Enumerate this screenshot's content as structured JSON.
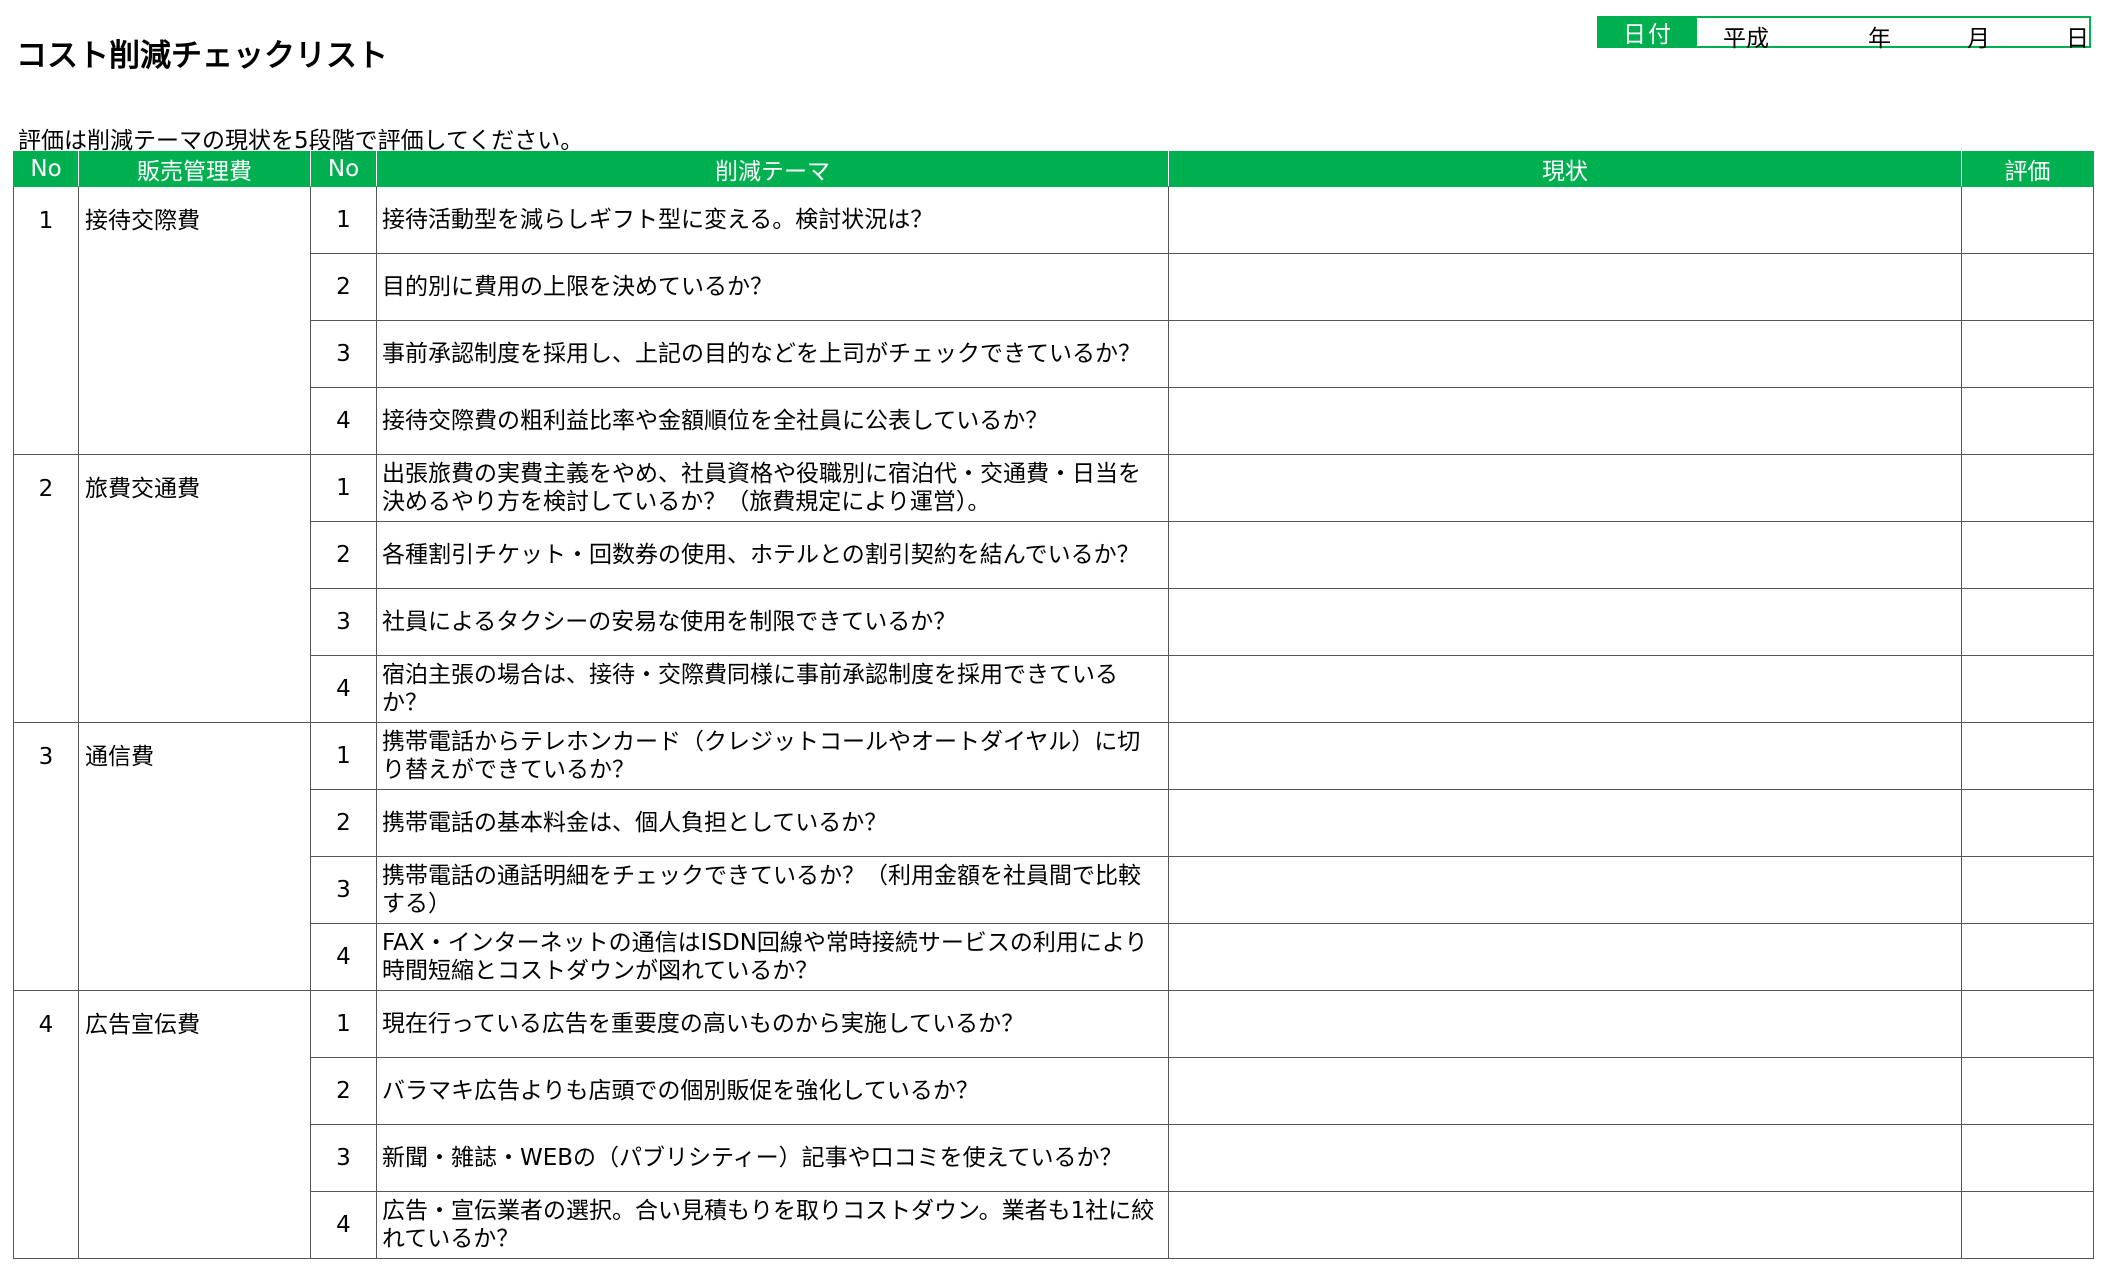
{
  "title": "コスト削減チェックリスト",
  "date": {
    "label": "日付",
    "era": "平成",
    "year": "年",
    "month": "月",
    "day": "日"
  },
  "instruction": "評価は削減テーマの現状を5段階で評価してください。",
  "table": {
    "headers": [
      "No",
      "販売管理費",
      "No",
      "削減テーマ",
      "現状",
      "評価"
    ],
    "groups": [
      {
        "no": "1",
        "name": "接待交際費",
        "items": [
          {
            "no": "1",
            "theme": "接待活動型を減らしギフト型に変える。検討状況は？"
          },
          {
            "no": "2",
            "theme": "目的別に費用の上限を決めているか？"
          },
          {
            "no": "3",
            "theme": "事前承認制度を採用し、上記の目的などを上司がチェックできているか？"
          },
          {
            "no": "4",
            "theme": "接待交際費の粗利益比率や金額順位を全社員に公表しているか？"
          }
        ]
      },
      {
        "no": "2",
        "name": "旅費交通費",
        "items": [
          {
            "no": "1",
            "theme": "出張旅費の実費主義をやめ、社員資格や役職別に宿泊代・交通費・日当を決めるやり方を検討しているか？（旅費規定により運営）。"
          },
          {
            "no": "2",
            "theme": "各種割引チケット・回数券の使用、ホテルとの割引契約を結んでいるか？"
          },
          {
            "no": "3",
            "theme": "社員によるタクシーの安易な使用を制限できているか？"
          },
          {
            "no": "4",
            "theme": "宿泊主張の場合は、接待・交際費同様に事前承認制度を採用できているか？"
          }
        ]
      },
      {
        "no": "3",
        "name": "通信費",
        "items": [
          {
            "no": "1",
            "theme": "携帯電話からテレホンカード（クレジットコールやオートダイヤル）に切り替えができているか？"
          },
          {
            "no": "2",
            "theme": "携帯電話の基本料金は、個人負担としているか？"
          },
          {
            "no": "3",
            "theme": "携帯電話の通話明細をチェックできているか？（利用金額を社員間で比較する）"
          },
          {
            "no": "4",
            "theme": "FAX・インターネットの通信はISDN回線や常時接続サービスの利用により時間短縮とコストダウンが図れているか？"
          }
        ]
      },
      {
        "no": "4",
        "name": "広告宣伝費",
        "items": [
          {
            "no": "1",
            "theme": "現在行っている広告を重要度の高いものから実施しているか？"
          },
          {
            "no": "2",
            "theme": "バラマキ広告よりも店頭での個別販促を強化しているか？"
          },
          {
            "no": "3",
            "theme": "新聞・雑誌・WEBの（パブリシティー）記事や口コミを使えているか？"
          },
          {
            "no": "4",
            "theme": "広告・宣伝業者の選択。合い見積もりを取りコストダウン。業者も1社に絞れているか？"
          }
        ]
      }
    ]
  }
}
